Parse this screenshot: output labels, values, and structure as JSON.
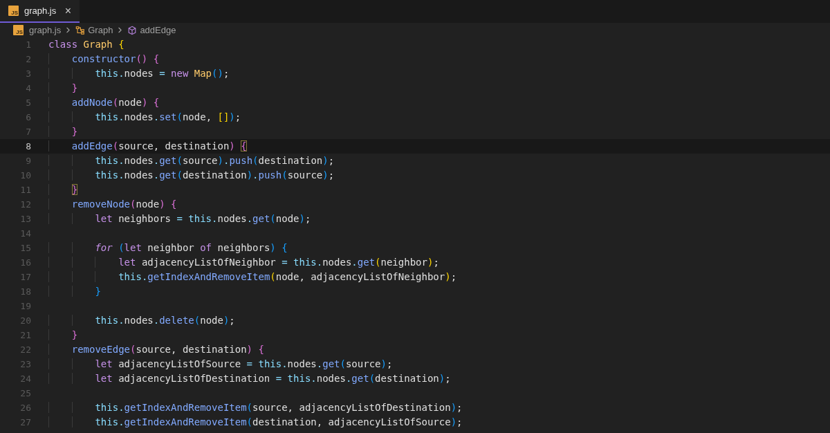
{
  "tabs": [
    {
      "icon_label": "JS",
      "title": "graph.js",
      "close": "×",
      "selected": true
    }
  ],
  "breadcrumb": {
    "file_icon_label": "JS",
    "file": "graph.js",
    "class_name": "Graph",
    "method": "addEdge"
  },
  "editor": {
    "lines": [
      {
        "number": "1",
        "current": false,
        "tokens": [
          {
            "kind": "kw",
            "text": "class "
          },
          {
            "kind": "cls",
            "text": "Graph "
          },
          {
            "kind": "b1",
            "text": "{"
          }
        ]
      },
      {
        "number": "2",
        "current": false,
        "tokens": [
          {
            "kind": "fn",
            "text": "    constructor"
          },
          {
            "kind": "b2",
            "text": "() {"
          }
        ]
      },
      {
        "number": "3",
        "current": false,
        "tokens": [
          {
            "kind": "this",
            "text": "        this"
          },
          {
            "kind": "op",
            "text": "."
          },
          {
            "kind": "plain",
            "text": "nodes "
          },
          {
            "kind": "op",
            "text": "= "
          },
          {
            "kind": "kw",
            "text": "new "
          },
          {
            "kind": "cls",
            "text": "Map"
          },
          {
            "kind": "b3",
            "text": "()"
          },
          {
            "kind": "plain",
            "text": ";"
          }
        ]
      },
      {
        "number": "4",
        "current": false,
        "tokens": [
          {
            "kind": "b2",
            "text": "    }"
          }
        ]
      },
      {
        "number": "5",
        "current": false,
        "tokens": [
          {
            "kind": "fn",
            "text": "    addNode"
          },
          {
            "kind": "b2",
            "text": "("
          },
          {
            "kind": "plain",
            "text": "node"
          },
          {
            "kind": "b2",
            "text": ") {"
          }
        ]
      },
      {
        "number": "6",
        "current": false,
        "tokens": [
          {
            "kind": "this",
            "text": "        this"
          },
          {
            "kind": "op",
            "text": "."
          },
          {
            "kind": "plain",
            "text": "nodes"
          },
          {
            "kind": "op",
            "text": "."
          },
          {
            "kind": "fn",
            "text": "set"
          },
          {
            "kind": "b3",
            "text": "("
          },
          {
            "kind": "plain",
            "text": "node, "
          },
          {
            "kind": "b1",
            "text": "[]"
          },
          {
            "kind": "b3",
            "text": ")"
          },
          {
            "kind": "plain",
            "text": ";"
          }
        ]
      },
      {
        "number": "7",
        "current": false,
        "tokens": [
          {
            "kind": "b2",
            "text": "    }"
          }
        ]
      },
      {
        "number": "8",
        "current": true,
        "tokens": [
          {
            "kind": "fn",
            "text": "    addEdge"
          },
          {
            "kind": "b2",
            "text": "("
          },
          {
            "kind": "plain",
            "text": "source, destination"
          },
          {
            "kind": "b2",
            "text": ") "
          },
          {
            "kind": "match",
            "text": "{"
          }
        ]
      },
      {
        "number": "9",
        "current": false,
        "tokens": [
          {
            "kind": "this",
            "text": "        this"
          },
          {
            "kind": "op",
            "text": "."
          },
          {
            "kind": "plain",
            "text": "nodes"
          },
          {
            "kind": "op",
            "text": "."
          },
          {
            "kind": "fn",
            "text": "get"
          },
          {
            "kind": "b3",
            "text": "("
          },
          {
            "kind": "plain",
            "text": "source"
          },
          {
            "kind": "b3",
            "text": ")"
          },
          {
            "kind": "op",
            "text": "."
          },
          {
            "kind": "fn",
            "text": "push"
          },
          {
            "kind": "b3",
            "text": "("
          },
          {
            "kind": "plain",
            "text": "destination"
          },
          {
            "kind": "b3",
            "text": ")"
          },
          {
            "kind": "plain",
            "text": ";"
          }
        ]
      },
      {
        "number": "10",
        "current": false,
        "tokens": [
          {
            "kind": "this",
            "text": "        this"
          },
          {
            "kind": "op",
            "text": "."
          },
          {
            "kind": "plain",
            "text": "nodes"
          },
          {
            "kind": "op",
            "text": "."
          },
          {
            "kind": "fn",
            "text": "get"
          },
          {
            "kind": "b3",
            "text": "("
          },
          {
            "kind": "plain",
            "text": "destination"
          },
          {
            "kind": "b3",
            "text": ")"
          },
          {
            "kind": "op",
            "text": "."
          },
          {
            "kind": "fn",
            "text": "push"
          },
          {
            "kind": "b3",
            "text": "("
          },
          {
            "kind": "plain",
            "text": "source"
          },
          {
            "kind": "b3",
            "text": ")"
          },
          {
            "kind": "plain",
            "text": ";"
          }
        ]
      },
      {
        "number": "11",
        "current": false,
        "tokens": [
          {
            "kind": "match",
            "text": "    }"
          }
        ]
      },
      {
        "number": "12",
        "current": false,
        "tokens": [
          {
            "kind": "fn",
            "text": "    removeNode"
          },
          {
            "kind": "b2",
            "text": "("
          },
          {
            "kind": "plain",
            "text": "node"
          },
          {
            "kind": "b2",
            "text": ") {"
          }
        ]
      },
      {
        "number": "13",
        "current": false,
        "tokens": [
          {
            "kind": "kw",
            "text": "        let "
          },
          {
            "kind": "plain",
            "text": "neighbors "
          },
          {
            "kind": "op",
            "text": "= "
          },
          {
            "kind": "this",
            "text": "this"
          },
          {
            "kind": "op",
            "text": "."
          },
          {
            "kind": "plain",
            "text": "nodes"
          },
          {
            "kind": "op",
            "text": "."
          },
          {
            "kind": "fn",
            "text": "get"
          },
          {
            "kind": "b3",
            "text": "("
          },
          {
            "kind": "plain",
            "text": "node"
          },
          {
            "kind": "b3",
            "text": ")"
          },
          {
            "kind": "plain",
            "text": ";"
          }
        ]
      },
      {
        "number": "14",
        "current": false
      },
      {
        "number": "15",
        "current": false,
        "tokens": [
          {
            "kind": "kwi",
            "text": "        for"
          },
          {
            "kind": "b3",
            "text": " ("
          },
          {
            "kind": "kw",
            "text": "let "
          },
          {
            "kind": "plain",
            "text": "neighbor "
          },
          {
            "kind": "kw",
            "text": "of "
          },
          {
            "kind": "plain",
            "text": "neighbors"
          },
          {
            "kind": "b3",
            "text": ") {"
          }
        ]
      },
      {
        "number": "16",
        "current": false,
        "tokens": [
          {
            "kind": "kw",
            "text": "            let "
          },
          {
            "kind": "plain",
            "text": "adjacencyListOfNeighbor "
          },
          {
            "kind": "op",
            "text": "= "
          },
          {
            "kind": "this",
            "text": "this"
          },
          {
            "kind": "op",
            "text": "."
          },
          {
            "kind": "plain",
            "text": "nodes"
          },
          {
            "kind": "op",
            "text": "."
          },
          {
            "kind": "fn",
            "text": "get"
          },
          {
            "kind": "b1",
            "text": "("
          },
          {
            "kind": "plain",
            "text": "neighbor"
          },
          {
            "kind": "b1",
            "text": ")"
          },
          {
            "kind": "plain",
            "text": ";"
          }
        ]
      },
      {
        "number": "17",
        "current": false,
        "tokens": [
          {
            "kind": "this",
            "text": "            this"
          },
          {
            "kind": "op",
            "text": "."
          },
          {
            "kind": "fn",
            "text": "getIndexAndRemoveItem"
          },
          {
            "kind": "b1",
            "text": "("
          },
          {
            "kind": "plain",
            "text": "node, adjacencyListOfNeighbor"
          },
          {
            "kind": "b1",
            "text": ")"
          },
          {
            "kind": "plain",
            "text": ";"
          }
        ]
      },
      {
        "number": "18",
        "current": false,
        "tokens": [
          {
            "kind": "b3",
            "text": "        }"
          }
        ]
      },
      {
        "number": "19",
        "current": false
      },
      {
        "number": "20",
        "current": false,
        "tokens": [
          {
            "kind": "this",
            "text": "        this"
          },
          {
            "kind": "op",
            "text": "."
          },
          {
            "kind": "plain",
            "text": "nodes"
          },
          {
            "kind": "op",
            "text": "."
          },
          {
            "kind": "fn",
            "text": "delete"
          },
          {
            "kind": "b3",
            "text": "("
          },
          {
            "kind": "plain",
            "text": "node"
          },
          {
            "kind": "b3",
            "text": ")"
          },
          {
            "kind": "plain",
            "text": ";"
          }
        ]
      },
      {
        "number": "21",
        "current": false,
        "tokens": [
          {
            "kind": "b2",
            "text": "    }"
          }
        ]
      },
      {
        "number": "22",
        "current": false,
        "tokens": [
          {
            "kind": "fn",
            "text": "    removeEdge"
          },
          {
            "kind": "b2",
            "text": "("
          },
          {
            "kind": "plain",
            "text": "source, destination"
          },
          {
            "kind": "b2",
            "text": ") {"
          }
        ]
      },
      {
        "number": "23",
        "current": false,
        "tokens": [
          {
            "kind": "kw",
            "text": "        let "
          },
          {
            "kind": "plain",
            "text": "adjacencyListOfSource "
          },
          {
            "kind": "op",
            "text": "= "
          },
          {
            "kind": "this",
            "text": "this"
          },
          {
            "kind": "op",
            "text": "."
          },
          {
            "kind": "plain",
            "text": "nodes"
          },
          {
            "kind": "op",
            "text": "."
          },
          {
            "kind": "fn",
            "text": "get"
          },
          {
            "kind": "b3",
            "text": "("
          },
          {
            "kind": "plain",
            "text": "source"
          },
          {
            "kind": "b3",
            "text": ")"
          },
          {
            "kind": "plain",
            "text": ";"
          }
        ]
      },
      {
        "number": "24",
        "current": false,
        "tokens": [
          {
            "kind": "kw",
            "text": "        let "
          },
          {
            "kind": "plain",
            "text": "adjacencyListOfDestination "
          },
          {
            "kind": "op",
            "text": "= "
          },
          {
            "kind": "this",
            "text": "this"
          },
          {
            "kind": "op",
            "text": "."
          },
          {
            "kind": "plain",
            "text": "nodes"
          },
          {
            "kind": "op",
            "text": "."
          },
          {
            "kind": "fn",
            "text": "get"
          },
          {
            "kind": "b3",
            "text": "("
          },
          {
            "kind": "plain",
            "text": "destination"
          },
          {
            "kind": "b3",
            "text": ")"
          },
          {
            "kind": "plain",
            "text": ";"
          }
        ]
      },
      {
        "number": "25",
        "current": false
      },
      {
        "number": "26",
        "current": false,
        "tokens": [
          {
            "kind": "this",
            "text": "        this"
          },
          {
            "kind": "op",
            "text": "."
          },
          {
            "kind": "fn",
            "text": "getIndexAndRemoveItem"
          },
          {
            "kind": "b3",
            "text": "("
          },
          {
            "kind": "plain",
            "text": "source, adjacencyListOfDestination"
          },
          {
            "kind": "b3",
            "text": ")"
          },
          {
            "kind": "plain",
            "text": ";"
          }
        ]
      },
      {
        "number": "27",
        "current": false,
        "tokens": [
          {
            "kind": "this",
            "text": "        this"
          },
          {
            "kind": "op",
            "text": "."
          },
          {
            "kind": "fn",
            "text": "getIndexAndRemoveItem"
          },
          {
            "kind": "b3",
            "text": "("
          },
          {
            "kind": "plain",
            "text": "destination, adjacencyListOfSource"
          },
          {
            "kind": "b3",
            "text": ")"
          },
          {
            "kind": "plain",
            "text": ";"
          }
        ]
      }
    ]
  }
}
